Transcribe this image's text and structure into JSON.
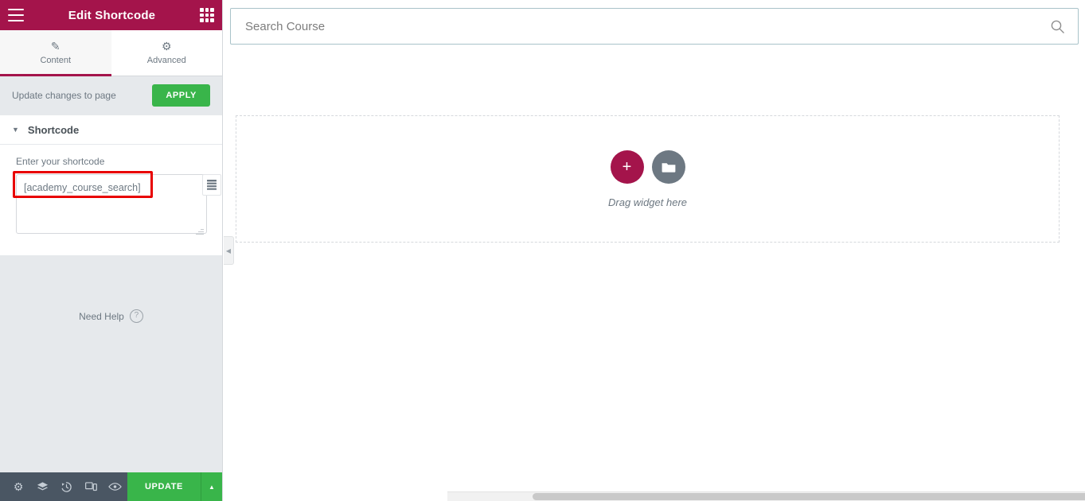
{
  "panel": {
    "header": {
      "title": "Edit Shortcode",
      "menu_icon": "hamburger-icon",
      "widgets_icon": "widgets-grid-icon"
    },
    "tabs": [
      {
        "label": "Content",
        "icon": "pencil-icon",
        "active": true
      },
      {
        "label": "Advanced",
        "icon": "gear-icon",
        "active": false
      }
    ],
    "apply_row": {
      "note": "Update changes to page",
      "button_label": "APPLY"
    },
    "section": {
      "title": "Shortcode",
      "caret_icon": "chevron-down-icon",
      "expanded": true
    },
    "control": {
      "label": "Enter your shortcode",
      "value": "[academy_course_search]",
      "placeholder": "Enter your shortcode",
      "side_button_icon": "database-list-icon"
    },
    "need_help": {
      "label": "Need Help",
      "icon": "question-circle-icon"
    },
    "footer": {
      "icons": [
        {
          "name": "settings-gear-icon",
          "glyph": "⚙"
        },
        {
          "name": "navigator-layers-icon",
          "glyph": "☰"
        },
        {
          "name": "history-revisions-icon",
          "glyph": "↺"
        },
        {
          "name": "responsive-mode-icon",
          "glyph": "❐"
        },
        {
          "name": "preview-eye-icon",
          "glyph": "◉"
        }
      ],
      "update_label": "UPDATE",
      "update_caret_icon": "chevron-up-icon"
    }
  },
  "canvas": {
    "search": {
      "placeholder": "Search Course",
      "value": "",
      "icon": "search-icon"
    },
    "dropzone": {
      "text": "Drag widget here",
      "add_icon": "plus-icon",
      "template_icon": "folder-icon"
    },
    "collapse_handle_icon": "chevron-left-icon"
  },
  "colors": {
    "brand_crimson": "#a4144b",
    "action_green": "#39b54a",
    "panel_bg": "#e6e9ec",
    "footer_bg": "#4a5663",
    "annotation_red": "#e80000",
    "search_border": "#a9c3c9"
  }
}
